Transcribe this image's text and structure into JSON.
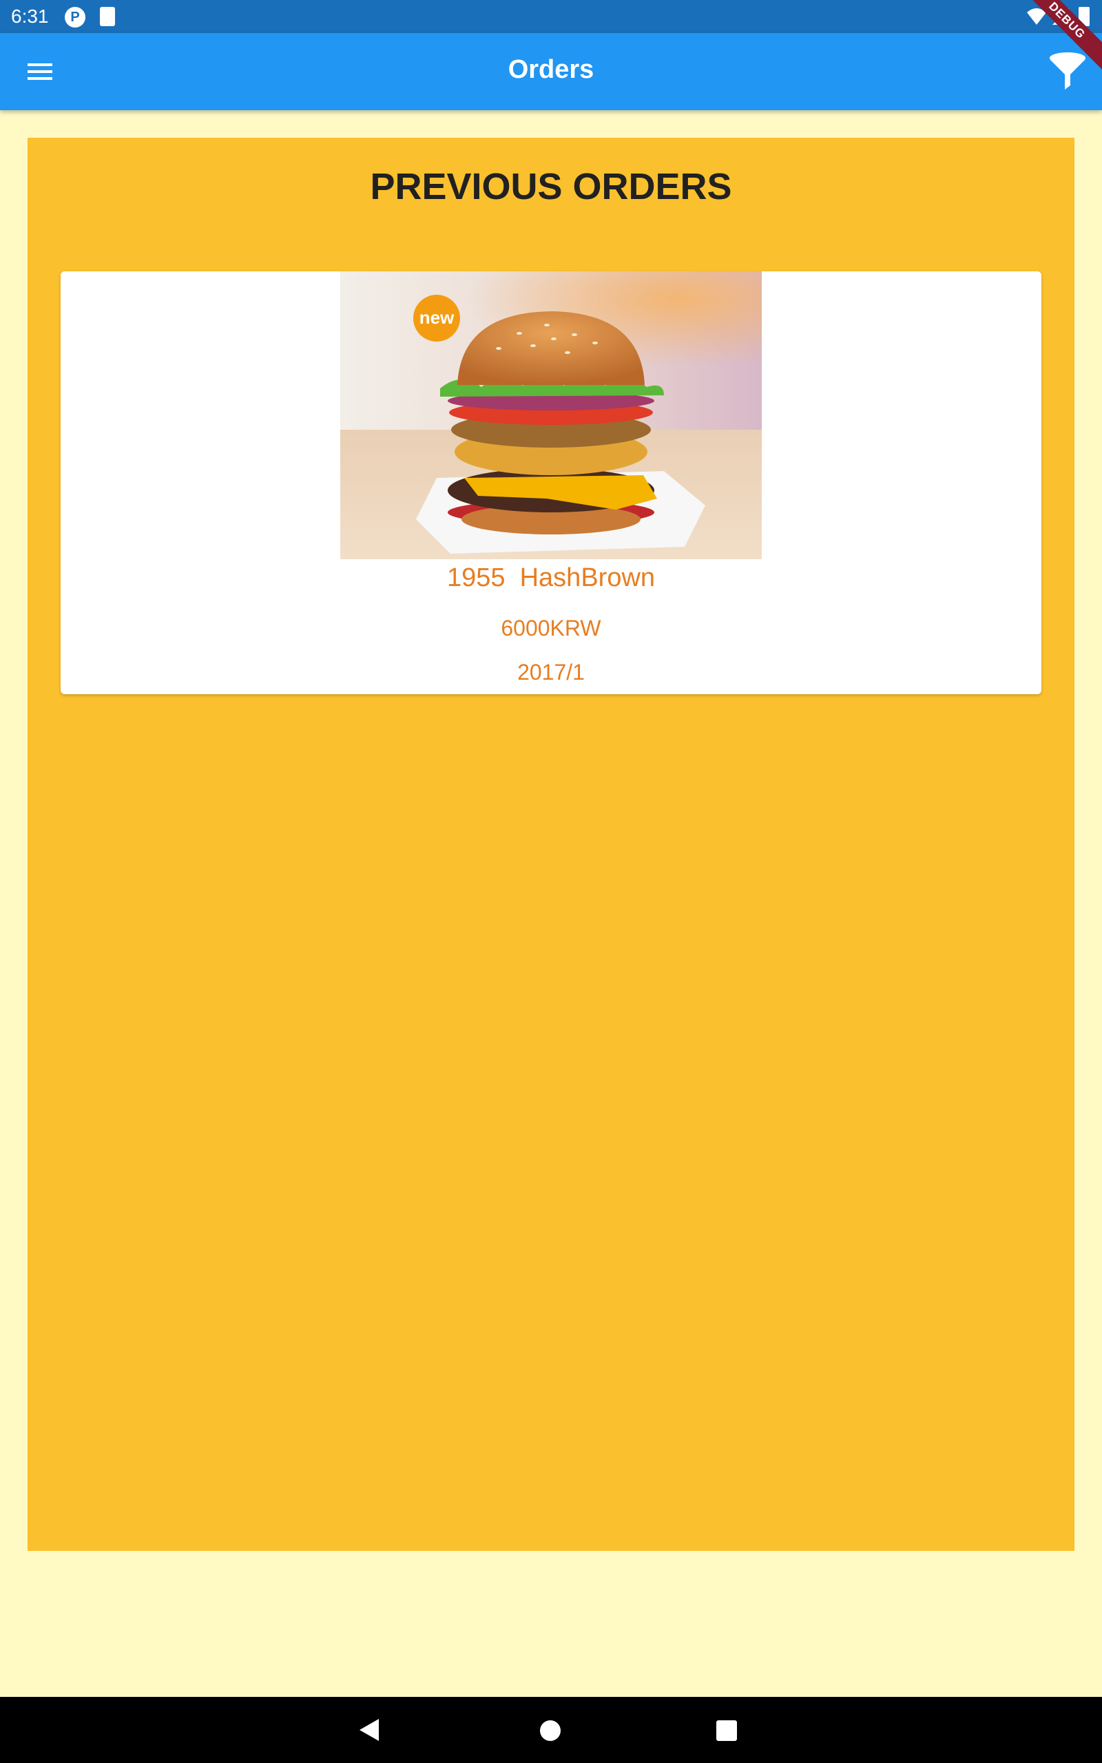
{
  "status_bar": {
    "time": "6:31",
    "icons": [
      "p-icon",
      "sd-card-icon",
      "wifi-icon",
      "signal-icon",
      "battery-icon"
    ]
  },
  "debug_banner": "DEBUG",
  "app_bar": {
    "title": "Orders",
    "menu_icon": "menu-icon",
    "filter_icon": "filter-icon",
    "color": "#2196F3"
  },
  "section": {
    "title": "PREVIOUS ORDERS",
    "background": "#FBC02D"
  },
  "orders": [
    {
      "badge": "new",
      "name": "1955  HashBrown",
      "price": "6000KRW",
      "date": "2017/1"
    }
  ],
  "nav_bar": {
    "icons": [
      "back-icon",
      "home-icon",
      "recents-icon"
    ]
  }
}
